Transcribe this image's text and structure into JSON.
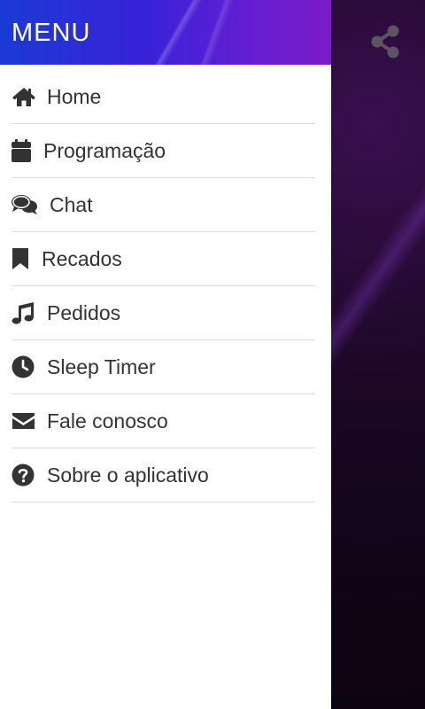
{
  "drawer": {
    "title": "MENU",
    "items": [
      {
        "label": "Home",
        "icon": "home-icon"
      },
      {
        "label": "Programação",
        "icon": "calendar-icon"
      },
      {
        "label": "Chat",
        "icon": "chat-bubbles-icon"
      },
      {
        "label": "Recados",
        "icon": "bookmark-icon"
      },
      {
        "label": "Pedidos",
        "icon": "music-note-icon"
      },
      {
        "label": "Sleep Timer",
        "icon": "clock-icon"
      },
      {
        "label": "Fale conosco",
        "icon": "envelope-icon"
      },
      {
        "label": "Sobre o aplicativo",
        "icon": "question-circle-icon"
      }
    ]
  },
  "app": {
    "share_icon": "share-icon"
  },
  "colors": {
    "header_gradient_start": "#1a3ad4",
    "header_gradient_end": "#7a1cc8",
    "icon_color": "#333333",
    "divider": "#dcdcdc"
  }
}
